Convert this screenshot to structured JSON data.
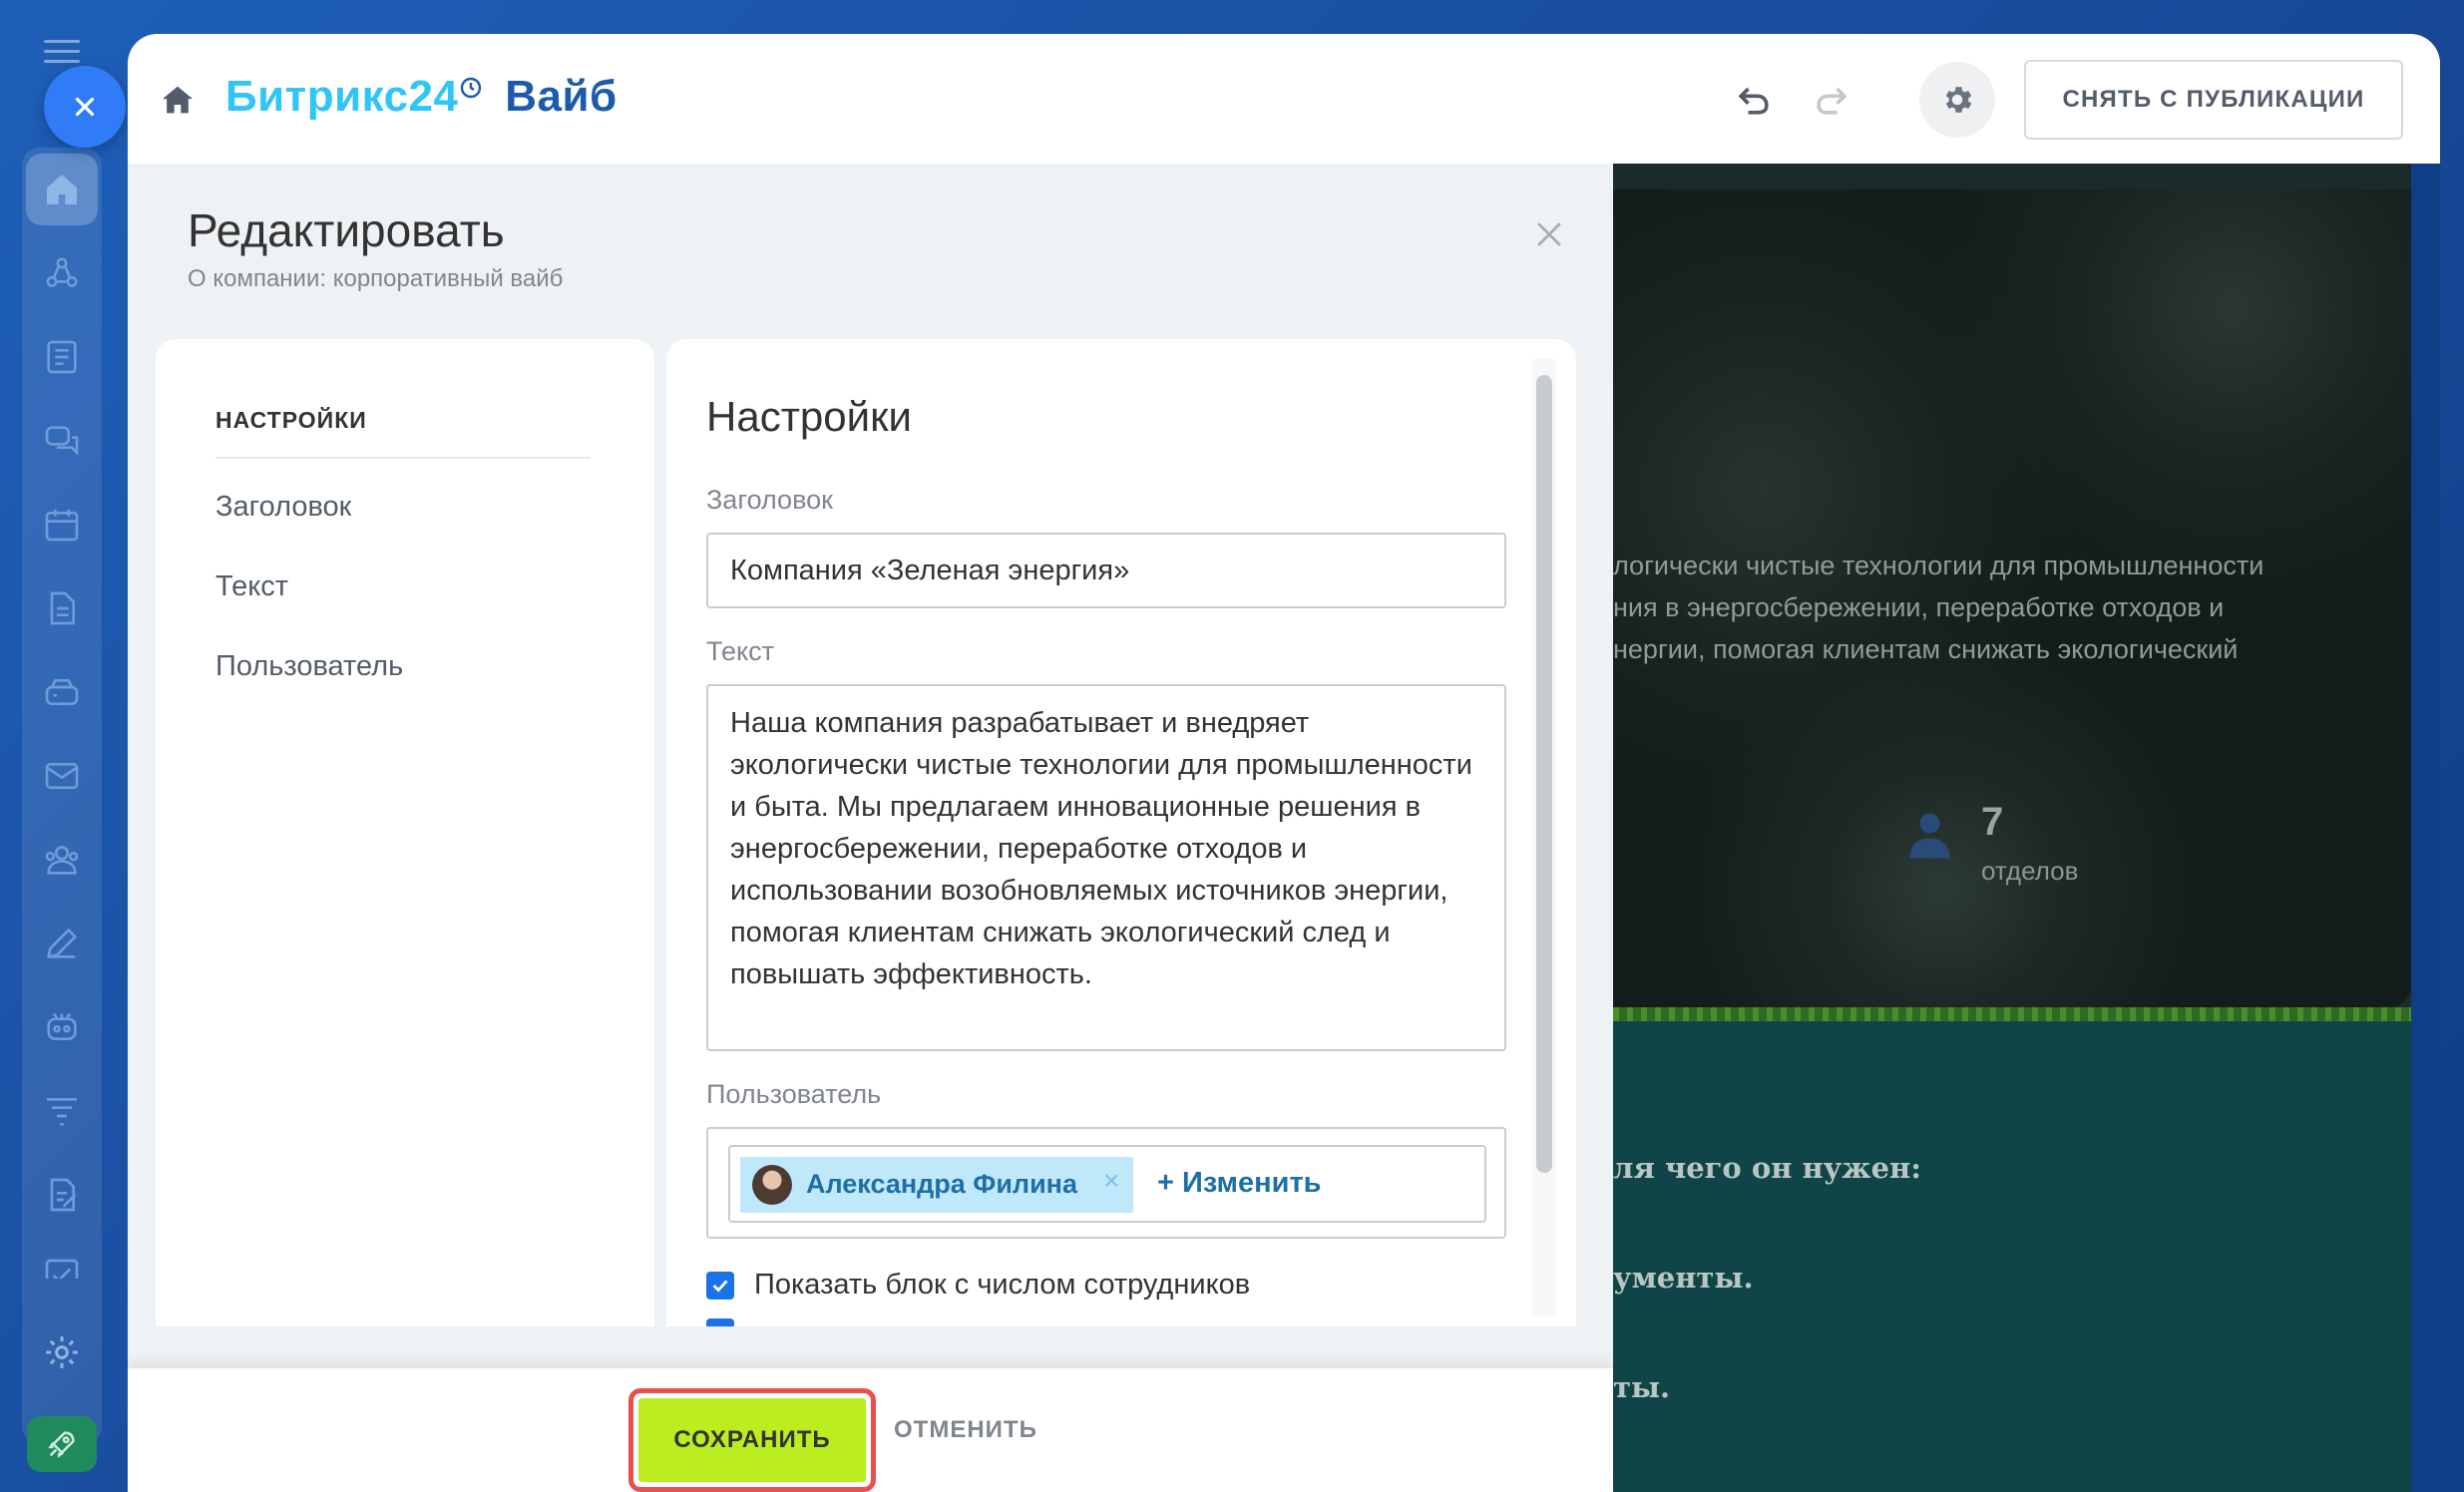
{
  "app": {
    "brand_part1": "Битрикс24",
    "brand_part2": "Вайб"
  },
  "toolbar": {
    "unpublish_label": "СНЯТЬ С ПУБЛИКАЦИИ"
  },
  "editor": {
    "title": "Редактировать",
    "subtitle": "О компании: корпоративный вайб"
  },
  "sidebar_menu": {
    "heading": "НАСТРОЙКИ",
    "items": [
      {
        "label": "Заголовок"
      },
      {
        "label": "Текст"
      },
      {
        "label": "Пользователь"
      }
    ]
  },
  "settings": {
    "title": "Настройки",
    "heading_label": "Заголовок",
    "heading_value": "Компания «Зеленая энергия»",
    "text_label": "Текст",
    "text_value": "Наша компания разрабатывает и внедряет экологически чистые технологии для промышленности и быта. Мы предлагаем инновационные решения в энергосбережении, переработке отходов и использовании возобновляемых источников энергии, помогая клиентам снижать экологический след и повышать эффективность.",
    "user_label": "Пользователь",
    "user_name": "Александра Филина",
    "change_link": "+ Изменить",
    "show_employees_label": "Показать блок с числом сотрудников",
    "show_employees_checked": true
  },
  "preview": {
    "text_lines": [
      "логически чистые технологии для промышленности",
      "ния в энергосбережении, переработке отходов и",
      "нергии, помогая клиентам снижать экологический"
    ],
    "departments_count": "7",
    "departments_label": "отделов",
    "bottom_lines": [
      "ля чего он нужен:",
      "ументы.",
      "ты."
    ]
  },
  "actions": {
    "save_label": "СОХРАНИТЬ",
    "cancel_label": "ОТМЕНИТЬ"
  },
  "colors": {
    "brand_light": "#2fc6f6",
    "brand_dark": "#1c5bab",
    "save_green": "#bbed21",
    "highlight_red": "#e8504d",
    "checkbox_blue": "#1a73e8"
  }
}
